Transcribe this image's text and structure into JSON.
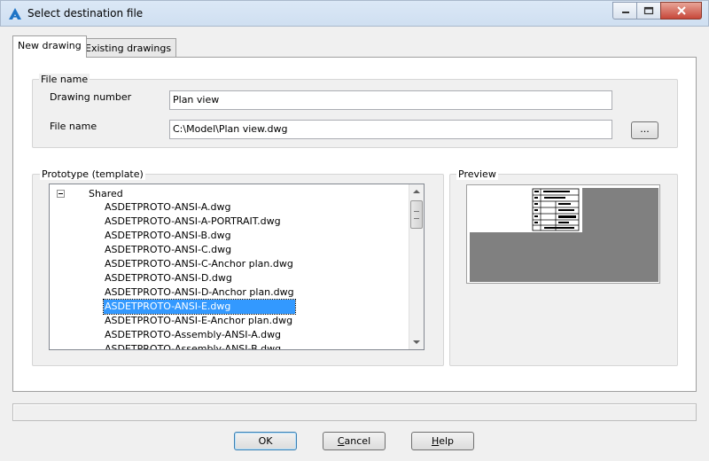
{
  "window": {
    "title": "Select destination file",
    "icon": "autocad-a-icon"
  },
  "tabs": [
    {
      "label": "New drawing",
      "active": true
    },
    {
      "label": "Existing drawings",
      "active": false
    }
  ],
  "file_name_group": {
    "title": "File name",
    "drawing_number_label": "Drawing number",
    "drawing_number_value": "Plan view",
    "file_name_label": "File name",
    "file_name_value": "C:\\Model\\Plan view.dwg",
    "browse_label": "..."
  },
  "prototype_group": {
    "title": "Prototype (template)",
    "root": "Shared",
    "items": [
      "ASDETPROTO-ANSI-A.dwg",
      "ASDETPROTO-ANSI-A-PORTRAIT.dwg",
      "ASDETPROTO-ANSI-B.dwg",
      "ASDETPROTO-ANSI-C.dwg",
      "ASDETPROTO-ANSI-C-Anchor plan.dwg",
      "ASDETPROTO-ANSI-D.dwg",
      "ASDETPROTO-ANSI-D-Anchor plan.dwg",
      "ASDETPROTO-ANSI-E.dwg",
      "ASDETPROTO-ANSI-E-Anchor plan.dwg",
      "ASDETPROTO-Assembly-ANSI-A.dwg",
      "ASDETPROTO-Assembly-ANSI-B.dwg"
    ],
    "selected_item": "ASDETPROTO-ANSI-E.dwg"
  },
  "preview_group": {
    "title": "Preview"
  },
  "status_text": "",
  "buttons": {
    "ok": "OK",
    "cancel_first": "C",
    "cancel_rest": "ancel",
    "help_first": "H",
    "help_rest": "elp"
  },
  "colors": {
    "selection": "#3399ff",
    "preview_gray": "#808080",
    "close_button": "#c7483a"
  }
}
